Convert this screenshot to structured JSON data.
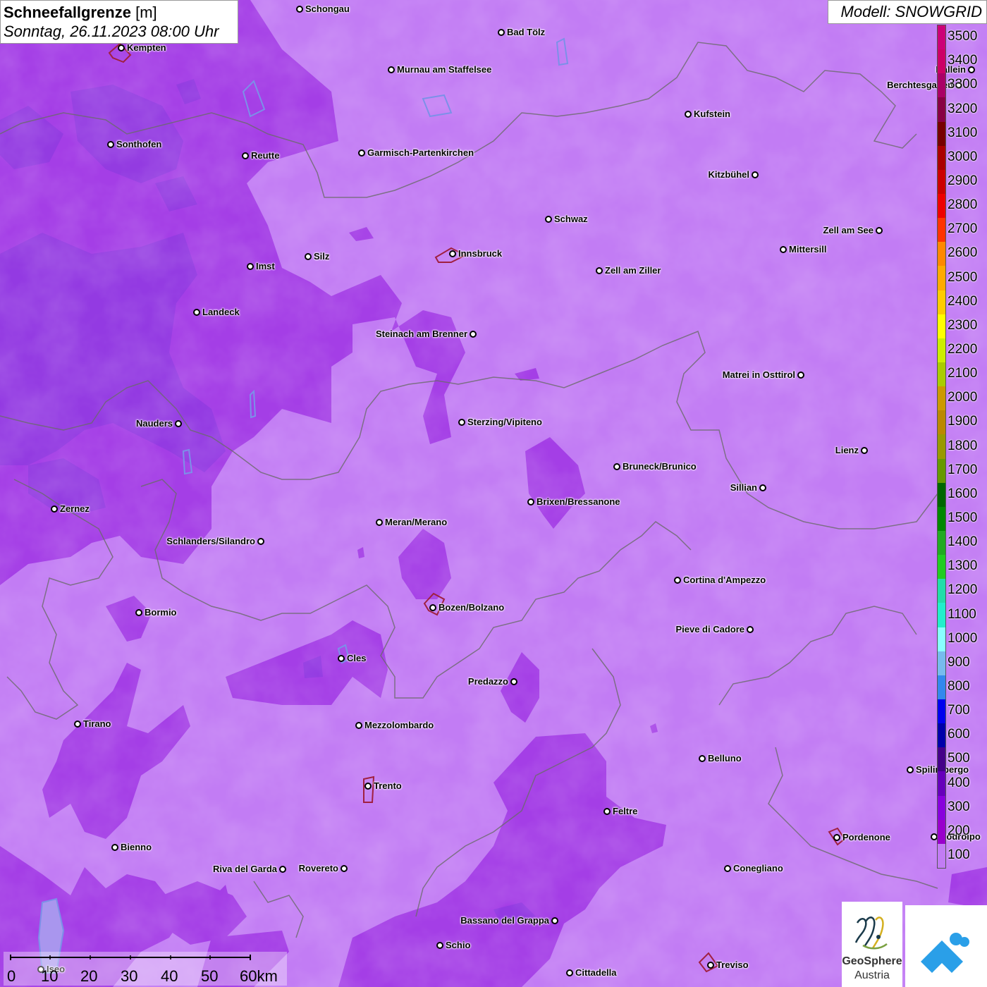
{
  "header": {
    "title_bold": "Schneefallgrenze",
    "title_unit": "[m]",
    "subtitle": "Sonntag, 26.11.2023 08:00 Uhr",
    "model": "Modell: SNOWGRID"
  },
  "legend": {
    "labels": [
      "3500",
      "3400",
      "3300",
      "3200",
      "3100",
      "3000",
      "2900",
      "2800",
      "2700",
      "2600",
      "2500",
      "2400",
      "2300",
      "2200",
      "2100",
      "2000",
      "1900",
      "1800",
      "1700",
      "1600",
      "1500",
      "1400",
      "1300",
      "1200",
      "1100",
      "1000",
      "900",
      "800",
      "700",
      "600",
      "500",
      "400",
      "300",
      "200",
      "100"
    ],
    "colors": [
      "#cc0077",
      "#cc0066",
      "#aa0066",
      "#880044",
      "#770000",
      "#aa0000",
      "#cc0000",
      "#ee0000",
      "#ff3300",
      "#ff8800",
      "#ffaa00",
      "#ffcc00",
      "#ffff00",
      "#ccee00",
      "#aacc00",
      "#cc9900",
      "#bb8800",
      "#999900",
      "#669900",
      "#006600",
      "#008800",
      "#22aa22",
      "#22cc22",
      "#22ddaa",
      "#22eecc",
      "#88ffff",
      "#77bbee",
      "#3388ee",
      "#0000ee",
      "#0000aa",
      "#440088",
      "#6600bb",
      "#8800dd",
      "#9900cc",
      "#c27cf4"
    ]
  },
  "cities": [
    {
      "name": "Schongau"
    },
    {
      "name": "Bad Tölz"
    },
    {
      "name": "Kempten"
    },
    {
      "name": "Murnau am Staffelsee"
    },
    {
      "name": "Hallein"
    },
    {
      "name": "Berchtesgaden"
    },
    {
      "name": "Kufstein"
    },
    {
      "name": "Sonthofen"
    },
    {
      "name": "Reutte"
    },
    {
      "name": "Garmisch-Partenkirchen"
    },
    {
      "name": "Kitzbühel"
    },
    {
      "name": "Schwaz"
    },
    {
      "name": "Zell am See"
    },
    {
      "name": "Innsbruck"
    },
    {
      "name": "Mittersill"
    },
    {
      "name": "Silz"
    },
    {
      "name": "Imst"
    },
    {
      "name": "Zell am Ziller"
    },
    {
      "name": "Landeck"
    },
    {
      "name": "Steinach am Brenner"
    },
    {
      "name": "Matrei in Osttirol"
    },
    {
      "name": "Nauders"
    },
    {
      "name": "Sterzing/Vipiteno"
    },
    {
      "name": "Lienz"
    },
    {
      "name": "Bruneck/Brunico"
    },
    {
      "name": "Sillian"
    },
    {
      "name": "Zernez"
    },
    {
      "name": "Brixen/Bressanone"
    },
    {
      "name": "Meran/Merano"
    },
    {
      "name": "Schlanders/Silandro"
    },
    {
      "name": "Cortina d'Ampezzo"
    },
    {
      "name": "Bozen/Bolzano"
    },
    {
      "name": "Bormio"
    },
    {
      "name": "Pieve di Cadore"
    },
    {
      "name": "Cles"
    },
    {
      "name": "Predazzo"
    },
    {
      "name": "Tirano"
    },
    {
      "name": "Mezzolombardo"
    },
    {
      "name": "Belluno"
    },
    {
      "name": "Spilimbergo"
    },
    {
      "name": "Trento"
    },
    {
      "name": "Feltre"
    },
    {
      "name": "Bienno"
    },
    {
      "name": "Pordenone"
    },
    {
      "name": "Codroipo"
    },
    {
      "name": "Riva del Garda"
    },
    {
      "name": "Rovereto"
    },
    {
      "name": "Conegliano"
    },
    {
      "name": "Bassano del Grappa"
    },
    {
      "name": "Schio"
    },
    {
      "name": "Treviso"
    },
    {
      "name": "Cittadella"
    },
    {
      "name": "Iseo"
    }
  ],
  "scale": {
    "labels": [
      "0",
      "10",
      "20",
      "30",
      "40",
      "50",
      "60km"
    ]
  },
  "logos": {
    "geosphere_line1": "GeoSphere",
    "geosphere_line2": "Austria"
  }
}
